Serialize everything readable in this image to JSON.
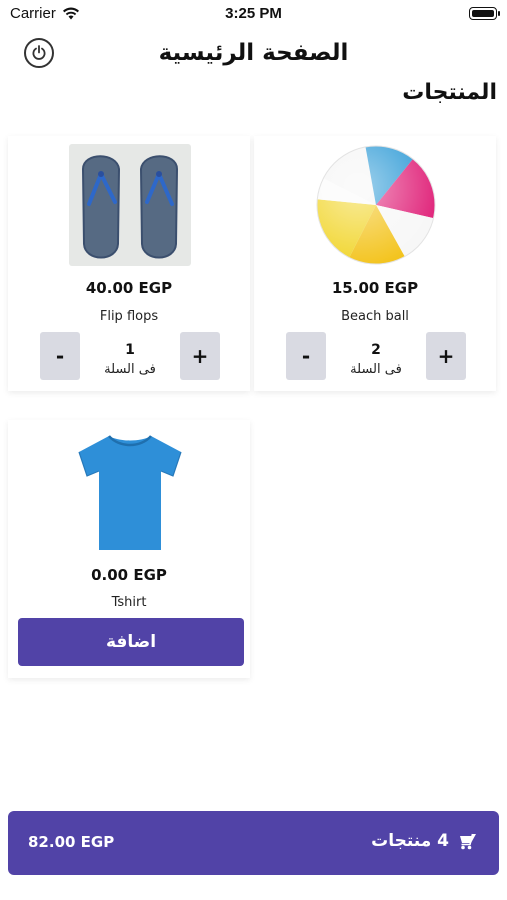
{
  "status_bar": {
    "carrier": "Carrier",
    "time": "3:25 PM"
  },
  "nav": {
    "title": "الصفحة الرئيسية"
  },
  "section": {
    "title": "المنتجات"
  },
  "products": [
    {
      "name": "Beach ball",
      "price": "15.00 EGP",
      "quantity": "2",
      "in_cart_label": "فى السلة",
      "minus": "-",
      "plus": "+"
    },
    {
      "name": "Flip flops",
      "price": "40.00 EGP",
      "quantity": "1",
      "in_cart_label": "فى السلة",
      "minus": "-",
      "plus": "+"
    },
    {
      "name": "Tshirt",
      "price": "0.00 EGP",
      "add_label": "اضافة"
    }
  ],
  "cart": {
    "total": "82.00 EGP",
    "count_label": "4 منتجات"
  },
  "colors": {
    "accent": "#5143a7",
    "stepper_bg": "#d9dae2"
  }
}
